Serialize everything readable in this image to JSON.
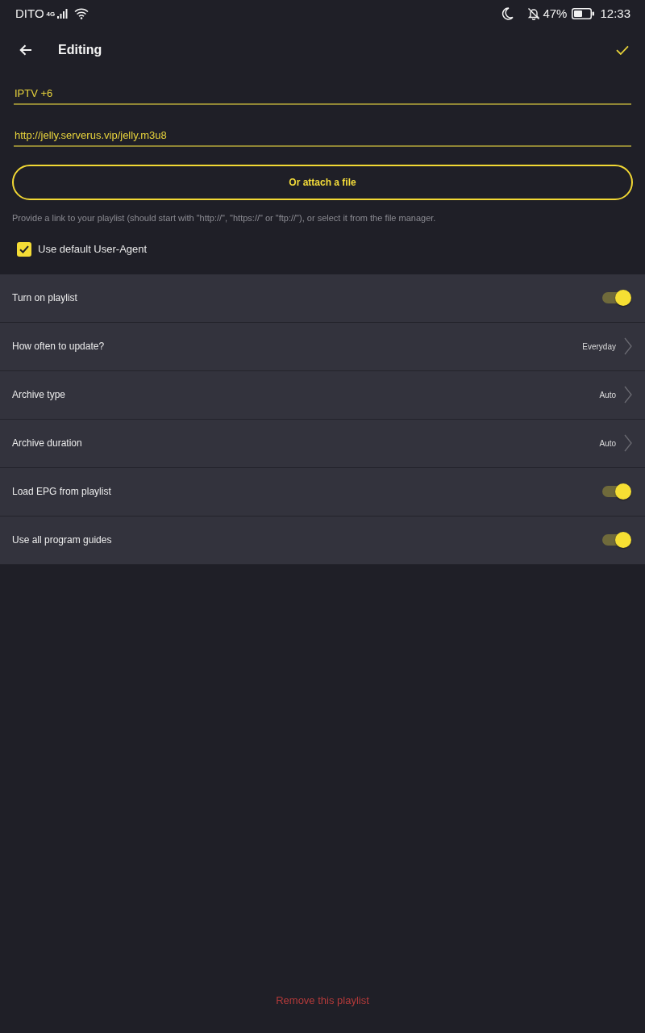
{
  "status_bar": {
    "carrier": "DITO",
    "network": "4G",
    "battery": "47%",
    "time": "12:33"
  },
  "toolbar": {
    "title": "Editing"
  },
  "form": {
    "name_field": {
      "value": "IPTV +6"
    },
    "url_field": {
      "value": "http://jelly.serverus.vip/jelly.m3u8"
    },
    "attach_button": "Or attach a file",
    "hint": "Provide a link to your playlist (should start with \"http://\", \"https://\" or \"ftp://\"), or select it from the file manager.",
    "user_agent": {
      "label": "Use default User-Agent",
      "checked": true
    }
  },
  "settings": [
    {
      "kind": "toggle",
      "label": "Turn on playlist",
      "on": true
    },
    {
      "kind": "choice",
      "label": "How often to update?",
      "value": "Everyday"
    },
    {
      "kind": "choice",
      "label": "Archive type",
      "value": "Auto"
    },
    {
      "kind": "choice",
      "label": "Archive duration",
      "value": "Auto"
    },
    {
      "kind": "toggle",
      "label": "Load EPG from playlist",
      "on": true
    },
    {
      "kind": "toggle",
      "label": "Use all program guides",
      "on": true
    }
  ],
  "remove_link": "Remove this playlist"
}
